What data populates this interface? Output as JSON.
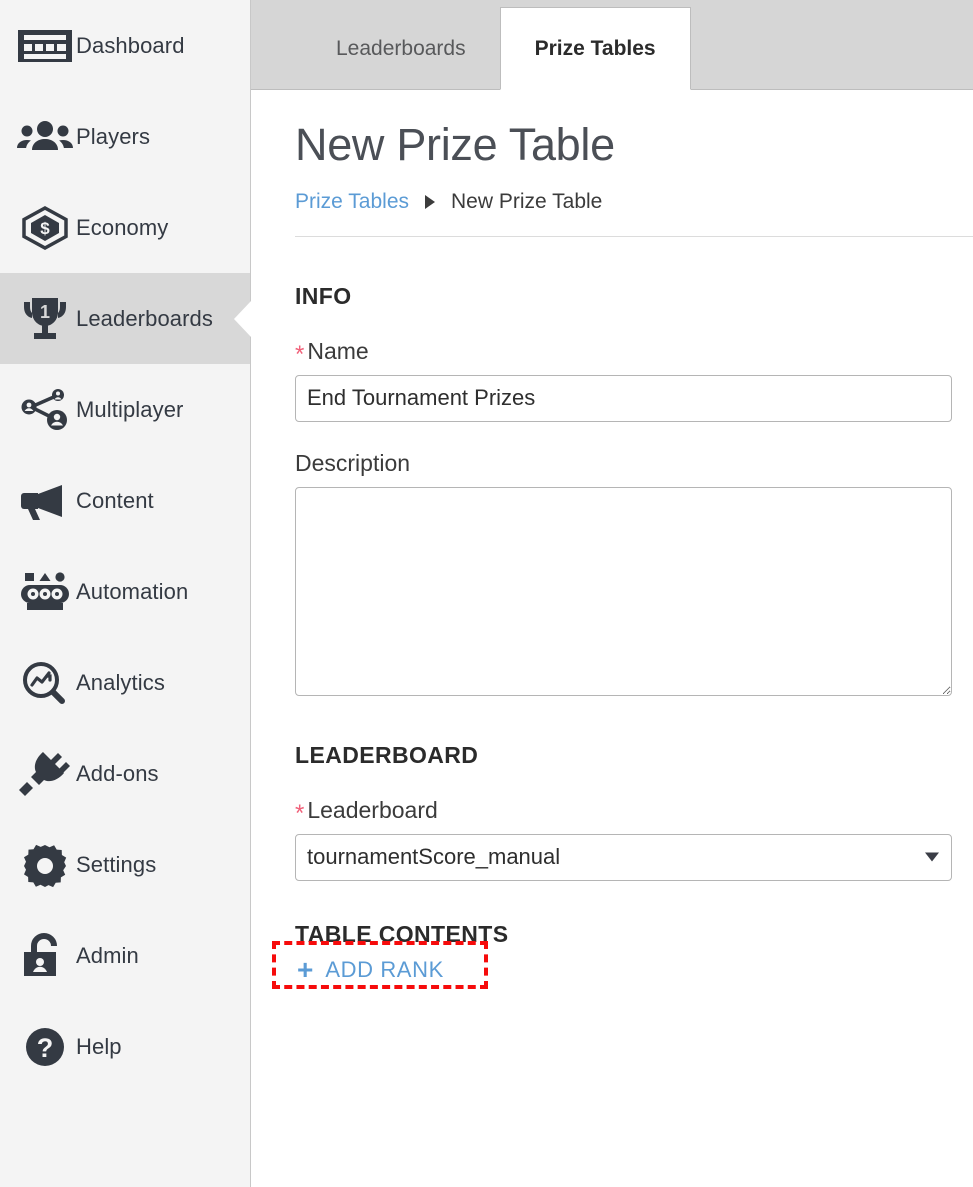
{
  "sidebar": {
    "items": [
      {
        "label": "Dashboard",
        "icon": "dashboard-icon",
        "active": false
      },
      {
        "label": "Players",
        "icon": "players-icon",
        "active": false
      },
      {
        "label": "Economy",
        "icon": "economy-icon",
        "active": false
      },
      {
        "label": "Leaderboards",
        "icon": "trophy-icon",
        "active": true
      },
      {
        "label": "Multiplayer",
        "icon": "multiplayer-icon",
        "active": false
      },
      {
        "label": "Content",
        "icon": "megaphone-icon",
        "active": false
      },
      {
        "label": "Automation",
        "icon": "automation-icon",
        "active": false
      },
      {
        "label": "Analytics",
        "icon": "magnifier-chart-icon",
        "active": false
      },
      {
        "label": "Add-ons",
        "icon": "plug-icon",
        "active": false
      },
      {
        "label": "Settings",
        "icon": "gear-icon",
        "active": false
      },
      {
        "label": "Admin",
        "icon": "lock-user-icon",
        "active": false
      },
      {
        "label": "Help",
        "icon": "question-icon",
        "active": false
      }
    ]
  },
  "tabs": [
    {
      "label": "Leaderboards",
      "active": false
    },
    {
      "label": "Prize Tables",
      "active": true
    }
  ],
  "header": {
    "title": "New Prize Table",
    "breadcrumb": {
      "parent": "Prize Tables",
      "separator": "caret-right-icon",
      "current": "New Prize Table"
    }
  },
  "form": {
    "info_section_title": "INFO",
    "name": {
      "label": "Name",
      "required_marker": "*",
      "value": "End Tournament Prizes",
      "placeholder": ""
    },
    "description": {
      "label": "Description",
      "value": "",
      "placeholder": ""
    },
    "leaderboard_section_title": "LEADERBOARD",
    "leaderboard": {
      "label": "Leaderboard",
      "required_marker": "*",
      "value": "tournamentScore_manual",
      "options": [
        "tournamentScore_manual"
      ],
      "caret": "chevron-down-icon"
    },
    "table_contents_section_title": "TABLE CONTENTS",
    "add_rank": {
      "plus": "+",
      "label": "ADD RANK",
      "highlighted": true
    }
  },
  "colors": {
    "sidebar_bg": "#f4f4f4",
    "sidebar_active_bg": "#d8d8d8",
    "tabbar_bg": "#d6d6d6",
    "accent_blue": "#5b9bd5",
    "required_red": "#f0617a",
    "highlight_red": "#f60b0b",
    "text_dark": "#343a43"
  }
}
